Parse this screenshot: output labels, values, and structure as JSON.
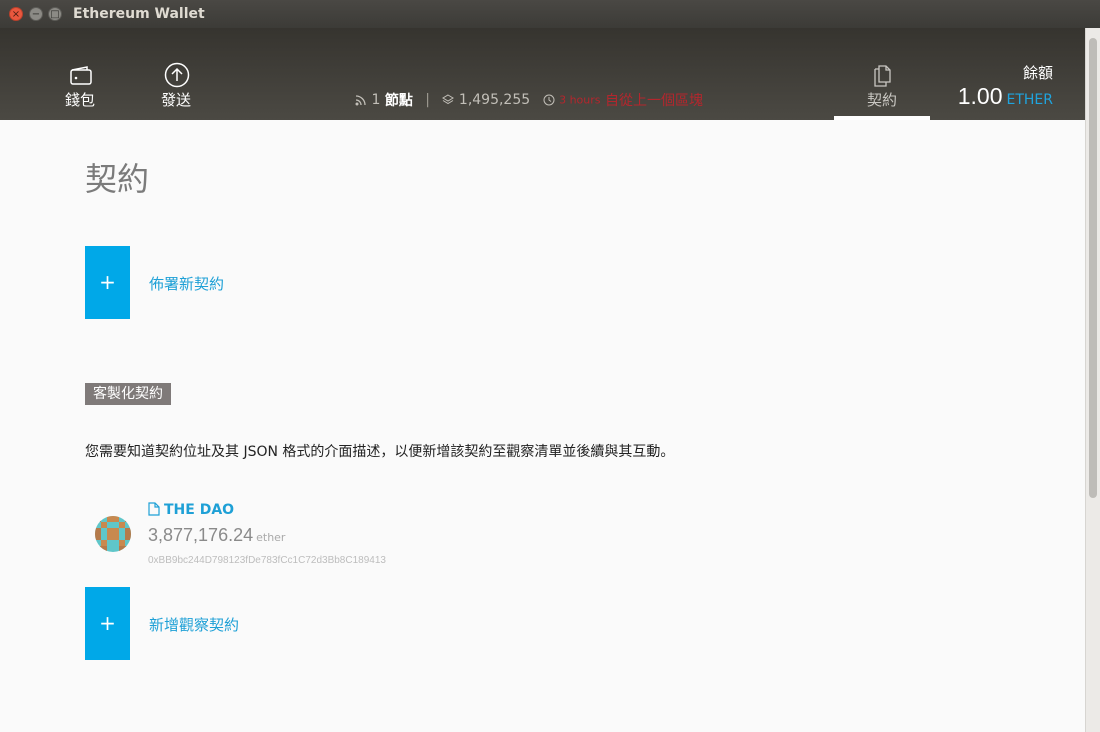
{
  "window": {
    "title": "Ethereum Wallet",
    "controls": {
      "close": "×",
      "minimize": "−",
      "maximize": "□"
    }
  },
  "nav": {
    "wallet": {
      "label": "錢包",
      "icon": "wallet-icon"
    },
    "send": {
      "label": "發送",
      "icon": "arrow-up-circle-icon"
    },
    "contracts": {
      "label": "契約",
      "icon": "documents-icon",
      "active": true
    }
  },
  "status": {
    "peers_count": "1",
    "peers_label": "節點",
    "separator": "|",
    "block_number": "1,495,255",
    "time_since": "3 hours",
    "since_label": "自從上一個區塊"
  },
  "balance": {
    "label": "餘額",
    "value": "1.00",
    "unit": "ETHER"
  },
  "page": {
    "title": "契約",
    "deploy_label": "佈署新契約",
    "plus": "+",
    "custom_section_label": "客製化契約",
    "description": "您需要知道契約位址及其 JSON 格式的介面描述，以便新增該契約至觀察清單並後續與其互動。",
    "watch_label": "新增觀察契約"
  },
  "contracts": [
    {
      "name": "THE DAO",
      "balance": "3,877,176.24",
      "unit": "ether",
      "address": "0xBB9bc244D798123fDe783fCc1C72d3Bb8C189413"
    }
  ],
  "colors": {
    "accent": "#00a8e8",
    "link": "#1ea0d6",
    "warning": "#b4262d",
    "header": "#3c3a35"
  }
}
